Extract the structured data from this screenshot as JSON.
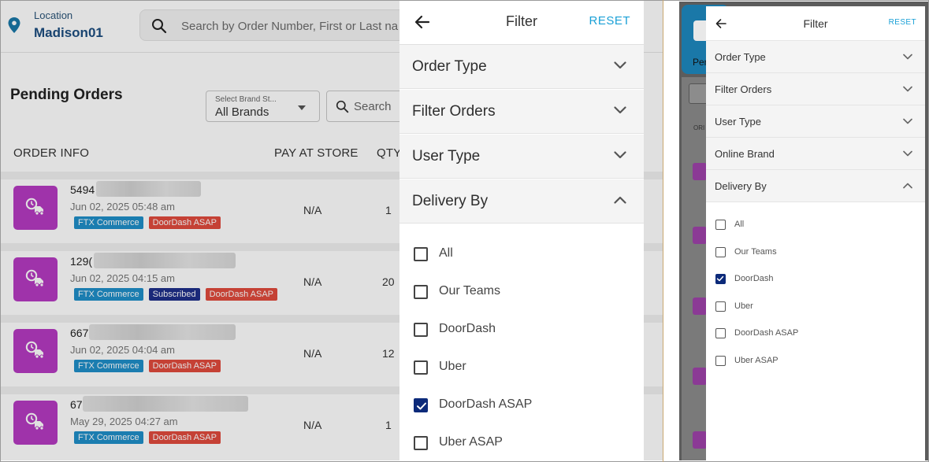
{
  "left": {
    "location": {
      "label": "Location",
      "value": "Madison01"
    },
    "search": {
      "placeholder": "Search by Order Number, First or Last na"
    },
    "page_title": "Pending Orders",
    "brand_select": {
      "label": "Select Brand St...",
      "value": "All Brands"
    },
    "order_search": {
      "placeholder": "Search"
    },
    "columns": {
      "order_info": "ORDER INFO",
      "pay_at_store": "PAY AT STORE",
      "qty": "QTY"
    },
    "orders": [
      {
        "id": "5494",
        "date": "Jun 02, 2025 05:48 am",
        "pay": "N/A",
        "qty": "1",
        "tags": [
          {
            "text": "FTX Commerce",
            "kind": "ftx"
          },
          {
            "text": "DoorDash ASAP",
            "kind": "dd"
          }
        ]
      },
      {
        "id": "129(",
        "date": "Jun 02, 2025 04:15 am",
        "pay": "N/A",
        "qty": "20",
        "tags": [
          {
            "text": "FTX Commerce",
            "kind": "ftx"
          },
          {
            "text": "Subscribed",
            "kind": "sub"
          },
          {
            "text": "DoorDash ASAP",
            "kind": "dd"
          }
        ]
      },
      {
        "id": "667",
        "date": "Jun 02, 2025 04:04 am",
        "pay": "N/A",
        "qty": "12",
        "tags": [
          {
            "text": "FTX Commerce",
            "kind": "ftx"
          },
          {
            "text": "DoorDash ASAP",
            "kind": "dd"
          }
        ]
      },
      {
        "id": "67",
        "date": "May 29, 2025 04:27 am",
        "pay": "N/A",
        "qty": "1",
        "tags": [
          {
            "text": "FTX Commerce",
            "kind": "ftx"
          },
          {
            "text": "DoorDash ASAP",
            "kind": "dd"
          }
        ]
      }
    ],
    "filter": {
      "title": "Filter",
      "reset": "RESET",
      "sections": [
        {
          "label": "Order Type",
          "expanded": false
        },
        {
          "label": "Filter Orders",
          "expanded": false
        },
        {
          "label": "User Type",
          "expanded": false
        },
        {
          "label": "Delivery By",
          "expanded": true
        }
      ],
      "options": [
        {
          "label": "All",
          "checked": false
        },
        {
          "label": "Our Teams",
          "checked": false
        },
        {
          "label": "DoorDash",
          "checked": false
        },
        {
          "label": "Uber",
          "checked": false
        },
        {
          "label": "DoorDash ASAP",
          "checked": true
        },
        {
          "label": "Uber ASAP",
          "checked": false
        }
      ]
    }
  },
  "right": {
    "bg_partial_text": "Per",
    "bg_column_text": "ORI",
    "filter": {
      "title": "Filter",
      "reset": "RESET",
      "sections": [
        {
          "label": "Order Type",
          "expanded": false
        },
        {
          "label": "Filter Orders",
          "expanded": false
        },
        {
          "label": "User Type",
          "expanded": false
        },
        {
          "label": "Online Brand",
          "expanded": false
        },
        {
          "label": "Delivery By",
          "expanded": true
        }
      ],
      "options": [
        {
          "label": "All",
          "checked": false
        },
        {
          "label": "Our Teams",
          "checked": false
        },
        {
          "label": "DoorDash",
          "checked": true
        },
        {
          "label": "Uber",
          "checked": false
        },
        {
          "label": "DoorDash ASAP",
          "checked": false
        },
        {
          "label": "Uber ASAP",
          "checked": false
        }
      ]
    }
  },
  "colors": {
    "accent": "#1aa0d6",
    "brand_navy": "#1d4e80",
    "order_icon": "#b63bc2",
    "tag_ftx": "#1f8fc9",
    "tag_doordash": "#e14a3d",
    "tag_subscribed": "#1e2f8a",
    "checkbox_checked": "#0c2a7a"
  },
  "icons": {
    "location": "location-pin-icon",
    "search": "search-icon",
    "back": "back-arrow-icon",
    "chevron_down": "chevron-down-icon",
    "chevron_up": "chevron-up-icon",
    "order": "delivery-truck-clock-icon",
    "check": "check-icon"
  }
}
